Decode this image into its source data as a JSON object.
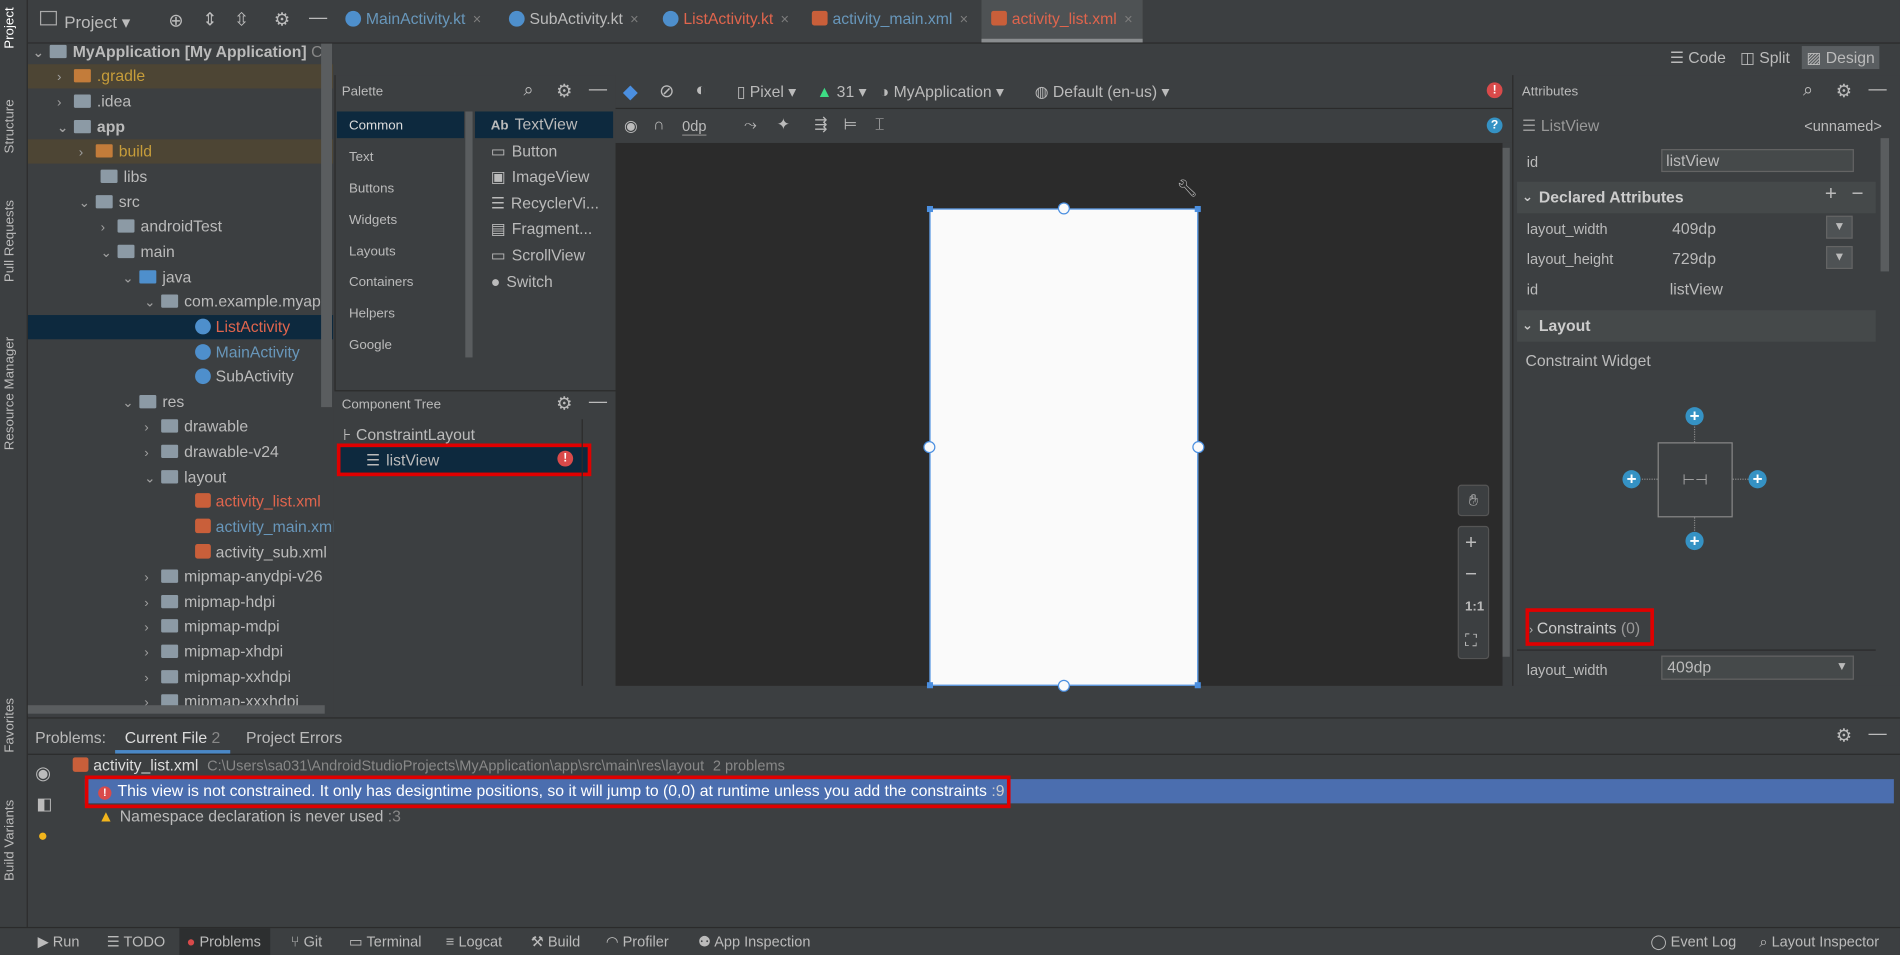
{
  "left_strip": {
    "project": "Project",
    "structure": "Structure",
    "pull_requests": "Pull Requests",
    "resource_manager": "Resource Manager",
    "favorites": "Favorites",
    "build_variants": "Build Variants"
  },
  "top": {
    "project_label": "Project",
    "tabs": [
      {
        "label": "MainActivity.kt",
        "color": "#6897bb"
      },
      {
        "label": "SubActivity.kt",
        "color": "#bbbbbb"
      },
      {
        "label": "ListActivity.kt",
        "color": "#e0654d"
      },
      {
        "label": "activity_main.xml",
        "color": "#6897bb"
      },
      {
        "label": "activity_list.xml",
        "color": "#e0654d"
      }
    ],
    "close_glyph": "×",
    "view_modes": {
      "code": "Code",
      "split": "Split",
      "design": "Design"
    }
  },
  "tree": {
    "root_name": "MyApplication",
    "root_module": "[My Application]",
    "root_path": "C:\\",
    "gradle": ".gradle",
    "idea": ".idea",
    "app": "app",
    "build": "build",
    "libs": "libs",
    "src": "src",
    "android_test": "androidTest",
    "main": "main",
    "java": "java",
    "package": "com.example.myapp",
    "list_activity": "ListActivity",
    "main_activity": "MainActivity",
    "sub_activity": "SubActivity",
    "res": "res",
    "drawable": "drawable",
    "drawable_v24": "drawable-v24",
    "layout": "layout",
    "activity_list": "activity_list.xml",
    "activity_main": "activity_main.xml",
    "activity_sub": "activity_sub.xml",
    "mipmap_anydpi": "mipmap-anydpi-v26",
    "mipmap_hdpi": "mipmap-hdpi",
    "mipmap_mdpi": "mipmap-mdpi",
    "mipmap_xhdpi": "mipmap-xhdpi",
    "mipmap_xxhdpi": "mipmap-xxhdpi",
    "mipmap_xxxhdpi": "mipmap-xxxhdpi"
  },
  "palette": {
    "title": "Palette",
    "categories": [
      "Common",
      "Text",
      "Buttons",
      "Widgets",
      "Layouts",
      "Containers",
      "Helpers",
      "Google"
    ],
    "items": [
      {
        "label": "TextView",
        "glyph": "Ab"
      },
      {
        "label": "Button",
        "glyph": "▭"
      },
      {
        "label": "ImageView",
        "glyph": "▣"
      },
      {
        "label": "RecyclerVi...",
        "glyph": "☰"
      },
      {
        "label": "Fragment...",
        "glyph": "▤"
      },
      {
        "label": "ScrollView",
        "glyph": "▭"
      },
      {
        "label": "Switch",
        "glyph": "●"
      }
    ]
  },
  "component_tree": {
    "title": "Component Tree",
    "root": "ConstraintLayout",
    "child": "listView"
  },
  "design_toolbar": {
    "device": "Pixel",
    "api": "31",
    "theme": "MyApplication",
    "locale": "Default (en-us)",
    "margin": "0dp"
  },
  "canvas_tools": {
    "fit": "1:1"
  },
  "attributes": {
    "title": "Attributes",
    "widget": "ListView",
    "unnamed": "<unnamed>",
    "id_label": "id",
    "id_value": "listView",
    "declared_title": "Declared Attributes",
    "declared": [
      {
        "name": "layout_width",
        "value": "409dp"
      },
      {
        "name": "layout_height",
        "value": "729dp"
      },
      {
        "name": "id",
        "value": "listView"
      }
    ],
    "layout_title": "Layout",
    "constraint_widget": "Constraint Widget",
    "constraints_label": "Constraints",
    "constraints_count": "(0)",
    "layout_width_label": "layout_width",
    "layout_width_value": "409dp"
  },
  "problems": {
    "label": "Problems:",
    "tab_current": "Current File",
    "tab_current_count": "2",
    "tab_project": "Project Errors",
    "file": "activity_list.xml",
    "path": "C:\\Users\\sa031\\AndroidStudioProjects\\MyApplication\\app\\src\\main\\res\\layout",
    "count_text": "2 problems",
    "error_msg": "This view is not constrained. It only has designtime positions, so it will jump to (0,0) at runtime unless you add the constraints",
    "error_line": ":9",
    "warn_msg": "Namespace declaration is never used",
    "warn_line": ":3"
  },
  "statusbar": {
    "run": "Run",
    "todo": "TODO",
    "problems": "Problems",
    "git": "Git",
    "terminal": "Terminal",
    "logcat": "Logcat",
    "build": "Build",
    "profiler": "Profiler",
    "app_inspection": "App Inspection",
    "event_log": "Event Log",
    "layout_inspector": "Layout Inspector"
  },
  "colors": {
    "accent_blue": "#4b8fe0",
    "error_red": "#e00000",
    "selection": "#0d293e",
    "problem_selected": "#4b6eaf"
  }
}
